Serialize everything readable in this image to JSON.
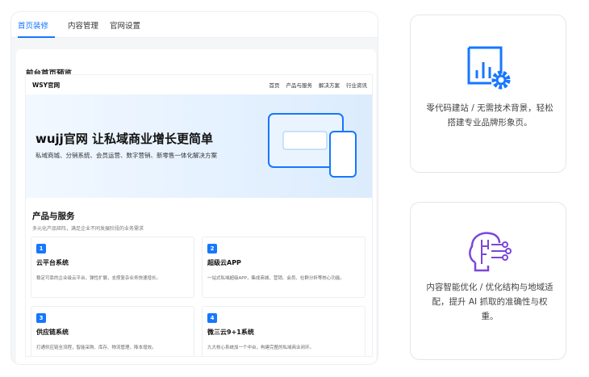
{
  "admin": {
    "tabs": [
      {
        "label": "首页装修",
        "active": true
      },
      {
        "label": "内容管理",
        "active": false
      },
      {
        "label": "官网设置",
        "active": false
      }
    ],
    "preview_title": "前台首页预览"
  },
  "site": {
    "brand": "WSY官网",
    "nav": [
      "首页",
      "产品与服务",
      "解决方案",
      "行业资讯"
    ],
    "hero": {
      "title": "wujj官网 让私域商业增长更简单",
      "subtitle": "私域商城、分销系统、会员运营、数字营销、新零售一体化解决方案"
    },
    "products": {
      "title": "产品与服务",
      "subtitle": "多元化产品矩阵，满足企业不同发展阶段的业务需求",
      "cards": [
        {
          "num": "1",
          "title": "云平台系统",
          "desc": "稳定可靠的企业级云平台，弹性扩展，支撑复杂业务快速增长。"
        },
        {
          "num": "2",
          "title": "超级云APP",
          "desc": "一站式私域超级APP，集成商城、营销、会员、社群分析等核心功能。"
        },
        {
          "num": "3",
          "title": "供应链系统",
          "desc": "打通供应链全流程，智能采购、库存、物流管理，降本增效。"
        },
        {
          "num": "4",
          "title": "微三云9+1系统",
          "desc": "九大核心系统加一个中台，构建完整的私域商业闭环。"
        }
      ]
    }
  },
  "features": [
    {
      "icon": "analytics-gear-icon",
      "text": "零代码建站 / 无需技术背景，轻松搭建专业品牌形象页。"
    },
    {
      "icon": "ai-brain-icon",
      "text": "内容智能优化 / 优化结构与地域适配，提升 AI 抓取的准确性与权重。"
    }
  ],
  "colors": {
    "accent": "#1677ff",
    "icon_blue": "#1677ff",
    "icon_purple": "#7b46d9"
  }
}
